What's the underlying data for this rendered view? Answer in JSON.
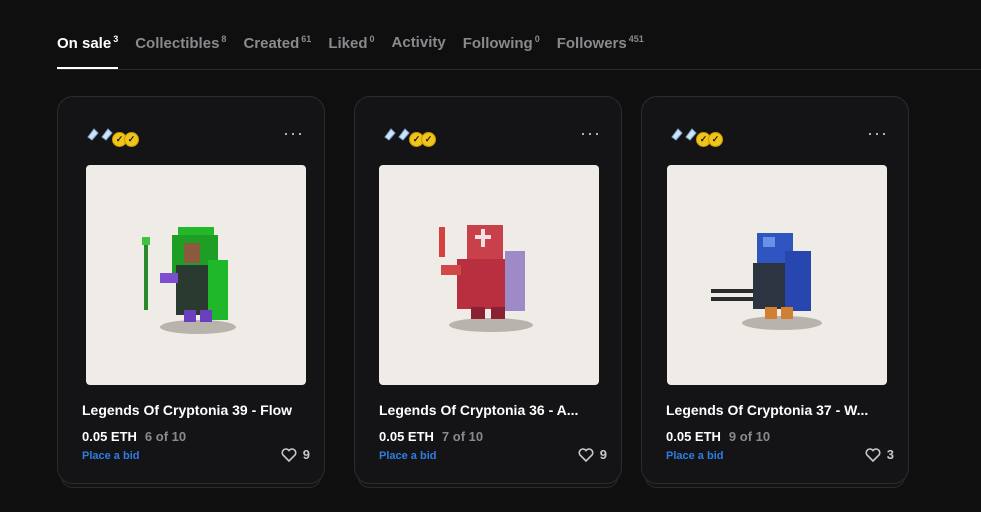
{
  "tabs": [
    {
      "label": "On sale",
      "count": "3",
      "active": true
    },
    {
      "label": "Collectibles",
      "count": "8"
    },
    {
      "label": "Created",
      "count": "61"
    },
    {
      "label": "Liked",
      "count": "0"
    },
    {
      "label": "Activity",
      "count": ""
    },
    {
      "label": "Following",
      "count": "0"
    },
    {
      "label": "Followers",
      "count": "451"
    }
  ],
  "colors": {
    "background": "#0f0f10",
    "card": "#141416",
    "accent_link": "#2f7de1",
    "muted_text": "#8a8a8e",
    "art_bg": "#efebe6",
    "verified_badge": "#f0c419"
  },
  "cards": [
    {
      "title": "Legends Of Cryptonia 39 - Flow",
      "price": "0.05 ETH",
      "edition": "6 of 10",
      "bid_label": "Place a bid",
      "likes": "9",
      "more_label": "···",
      "art_icon": "green-hooded-archer-sprite"
    },
    {
      "title": "Legends Of Cryptonia 36 - A...",
      "price": "0.05 ETH",
      "edition": "7 of 10",
      "bid_label": "Place a bid",
      "likes": "9",
      "more_label": "···",
      "art_icon": "red-armored-knight-sprite"
    },
    {
      "title": "Legends Of Cryptonia 37 - W...",
      "price": "0.05 ETH",
      "edition": "9 of 10",
      "bid_label": "Place a bid",
      "likes": "3",
      "more_label": "···",
      "art_icon": "blue-helmet-swordsman-sprite"
    }
  ]
}
